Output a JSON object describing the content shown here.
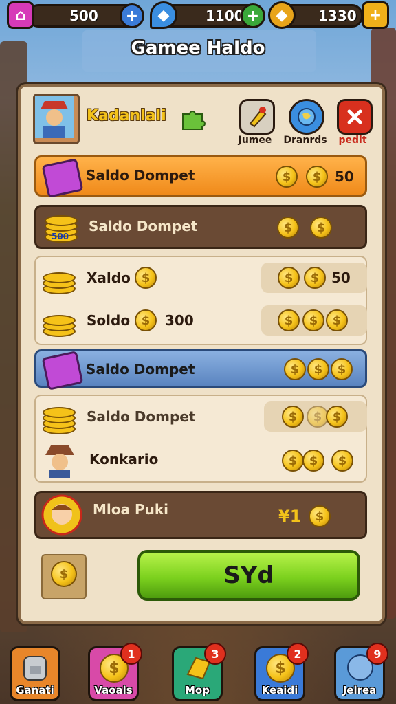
{
  "topbar": {
    "resources": [
      {
        "name": "home",
        "value": "500"
      },
      {
        "name": "gem",
        "value": "1100"
      },
      {
        "name": "gold",
        "value": "1330"
      }
    ]
  },
  "title": "Gamee Haldo",
  "header": {
    "player_name": "Kadanlali",
    "buttons": [
      {
        "label": "Jumee",
        "icon": "pencil-icon"
      },
      {
        "label": "Dranrds",
        "icon": "globe-icon"
      },
      {
        "label": "pedit",
        "icon": "close-icon"
      }
    ]
  },
  "rows": [
    {
      "label": "Saldo Dompet",
      "value": "50",
      "style": "orange"
    },
    {
      "label": "Saldo Dompet",
      "badge": "500",
      "style": "dark"
    },
    {
      "label": "Xaldo",
      "value": "50",
      "style": "light"
    },
    {
      "label": "Soldo",
      "value": "300",
      "style": "light"
    },
    {
      "label": "Saldo Dompet",
      "style": "blue"
    },
    {
      "label": "Saldo Dompet",
      "style": "light"
    },
    {
      "label": "Konkario",
      "style": "light"
    },
    {
      "label": "Mloa Puki",
      "value": "¥1",
      "style": "dark"
    }
  ],
  "action_button": "SYd",
  "nav": [
    {
      "label": "Ganati",
      "badge": ""
    },
    {
      "label": "Vaoals",
      "badge": "1"
    },
    {
      "label": "Mop",
      "badge": "3"
    },
    {
      "label": "Keaidi",
      "badge": "2"
    },
    {
      "label": "Jelrea",
      "badge": "9"
    }
  ],
  "colors": {
    "accent": "#f39b2a",
    "primary_button": "#7cd11e",
    "highlight_row": "#6a90c8",
    "panel": "#efe1c8"
  }
}
